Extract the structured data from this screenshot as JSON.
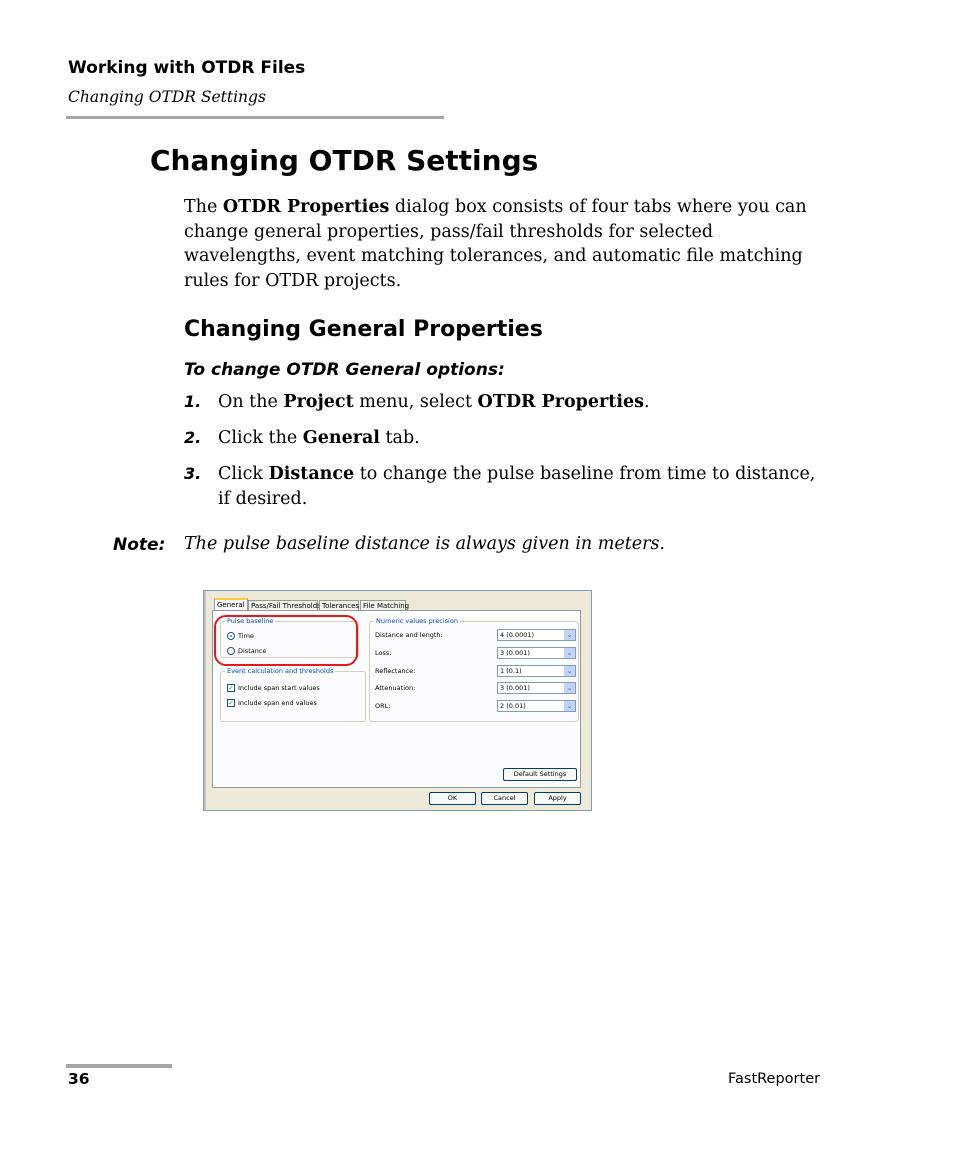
{
  "header": {
    "chapter": "Working with OTDR Files",
    "section": "Changing OTDR Settings"
  },
  "title": "Changing OTDR Settings",
  "intro": {
    "pre": "The ",
    "bold": "OTDR Properties",
    "post": " dialog box consists of four tabs where you can change general properties, pass/fail thresholds for selected wavelengths, event matching tolerances, and automatic file matching rules for OTDR projects."
  },
  "subtitle": "Changing General Properties",
  "procedure_title": "To change OTDR General options:",
  "steps": [
    {
      "num": "1.",
      "a": "On the ",
      "b1": "Project",
      "c": " menu, select ",
      "b2": "OTDR Properties",
      "d": "."
    },
    {
      "num": "2.",
      "a": "Click the ",
      "b1": "General",
      "c": " tab."
    },
    {
      "num": "3.",
      "a": "Click ",
      "b1": "Distance",
      "c": " to change the pulse baseline from time to distance, if desired."
    }
  ],
  "note": {
    "label": "Note:",
    "text": "The pulse baseline distance is always given in meters."
  },
  "dialog": {
    "tabs": [
      "General",
      "Pass/Fail Thresholds",
      "Tolerances",
      "File Matching"
    ],
    "pulse_group": "Pulse baseline",
    "radio_time": "Time",
    "radio_distance": "Distance",
    "event_group": "Event calculation and thresholds",
    "check_start": "Include span start values",
    "check_end": "Include span end values",
    "numeric_group": "Numeric values precision",
    "rows": [
      {
        "label": "Distance and length:",
        "value": "4 (0.0001)"
      },
      {
        "label": "Loss:",
        "value": "3 (0.001)"
      },
      {
        "label": "Reflectance:",
        "value": "1 (0.1)"
      },
      {
        "label": "Attenuation:",
        "value": "3 (0.001)"
      },
      {
        "label": "ORL:",
        "value": "2 (0.01)"
      }
    ],
    "default_btn": "Default Settings",
    "ok_btn": "OK",
    "cancel_btn": "Cancel",
    "apply_btn": "Apply",
    "checkmark": "✓",
    "dropdown_glyph": "⌄"
  },
  "footer": {
    "page_number": "36",
    "product": "FastReporter"
  }
}
